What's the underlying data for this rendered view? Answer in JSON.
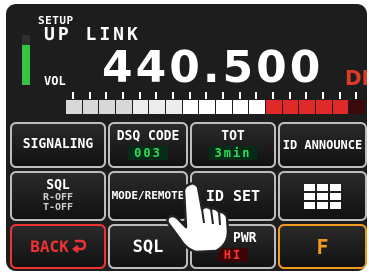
{
  "header": {
    "mode_label": "SETUP",
    "link_label": "UP LINK",
    "vol_label": "VOL",
    "frequency": "440.500",
    "direction": "DN"
  },
  "volume": {
    "level": 0.8
  },
  "signal_meter": {
    "segments": [
      {
        "color": "#d8d8d8"
      },
      {
        "color": "#d8d8d8"
      },
      {
        "color": "#d8d8d8"
      },
      {
        "color": "#d8d8d8"
      },
      {
        "color": "#ededed"
      },
      {
        "color": "#ededed"
      },
      {
        "color": "#ededed"
      },
      {
        "color": "#ffffff"
      },
      {
        "color": "#ffffff"
      },
      {
        "color": "#ffffff"
      },
      {
        "color": "#ffffff"
      },
      {
        "color": "#ffffff"
      },
      {
        "color": "#e02a2a"
      },
      {
        "color": "#e02a2a"
      },
      {
        "color": "#e02a2a"
      },
      {
        "color": "#e02a2a"
      },
      {
        "color": "#e02a2a"
      },
      {
        "color": "#3a0a0a"
      }
    ]
  },
  "buttons": {
    "signaling": "SIGNALING",
    "dsq_code_label": "DSQ CODE",
    "dsq_code_value": "003",
    "tot_label": "TOT",
    "tot_value": "3min",
    "id_announce": "ID ANNOUNCE",
    "sql_label": "SQL",
    "sql_r": "R-OFF",
    "sql_t": "T-OFF",
    "mode_remote": "MODE/REMOTE",
    "id_set": "ID SET",
    "back": "BACK",
    "sql_bottom": "SQL",
    "tx_pwr_label": "Tx PWR",
    "tx_pwr_value": "HI",
    "f": "F"
  },
  "colors": {
    "accent_green": "#2fdc5a",
    "alert_red": "#e03a27",
    "f_orange": "#f29a1f"
  }
}
